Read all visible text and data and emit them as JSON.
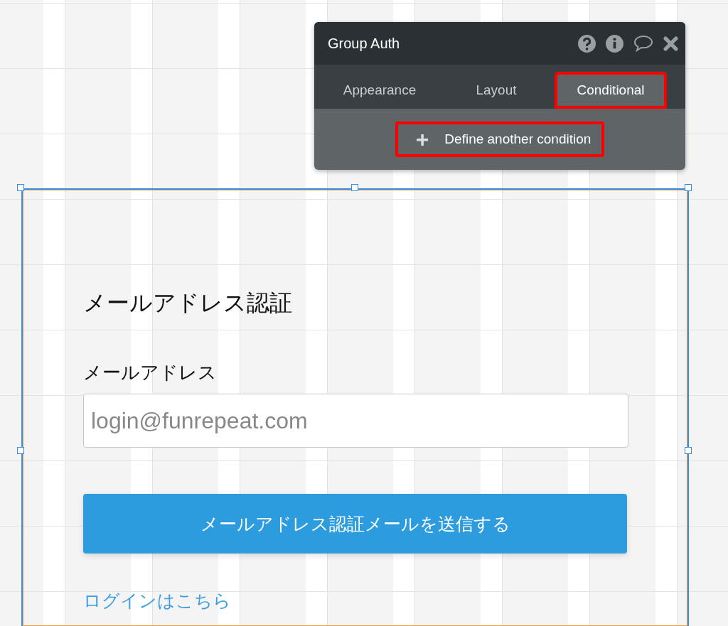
{
  "panel": {
    "title": "Group Auth",
    "tabs": [
      {
        "label": "Appearance",
        "selected": false,
        "highlighted": false
      },
      {
        "label": "Layout",
        "selected": false,
        "highlighted": false
      },
      {
        "label": "Conditional",
        "selected": true,
        "highlighted": true
      }
    ],
    "add_button": {
      "icon": "+",
      "label": "Define another condition",
      "highlighted": true
    }
  },
  "group": {
    "selected": true,
    "heading": "メールアドレス認証",
    "field_label": "メールアドレス",
    "email_field": {
      "placeholder": "login@funrepeat.com"
    },
    "submit_button": "メールアドレス認証メールを送信する",
    "login_link": "ログインはこちら"
  }
}
